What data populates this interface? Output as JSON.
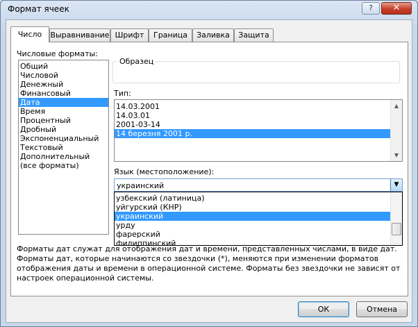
{
  "window": {
    "title": "Формат ячеек",
    "help_label": "?",
    "close_label": "✕"
  },
  "tabs": [
    {
      "label": "Число",
      "active": true
    },
    {
      "label": "Выравнивание",
      "active": false
    },
    {
      "label": "Шрифт",
      "active": false
    },
    {
      "label": "Граница",
      "active": false
    },
    {
      "label": "Заливка",
      "active": false
    },
    {
      "label": "Защита",
      "active": false
    }
  ],
  "formats": {
    "label": "Числовые форматы:",
    "items": [
      "Общий",
      "Числовой",
      "Денежный",
      "Финансовый",
      "Дата",
      "Время",
      "Процентный",
      "Дробный",
      "Экспоненциальный",
      "Текстовый",
      "Дополнительный",
      "(все форматы)"
    ],
    "selected_index": 4
  },
  "sample": {
    "label": "Образец"
  },
  "type": {
    "label": "Тип:",
    "items": [
      "14.03.2001",
      "14.03.01",
      "2001-03-14",
      "14 березня 2001 р."
    ],
    "selected_index": 3
  },
  "locale": {
    "label": "Язык (местоположение):",
    "value": "украинский",
    "options": [
      "узбекский (латиница)",
      "уйгурский (КНР)",
      "украинский",
      "урду",
      "фарерский",
      "филиппинский"
    ],
    "selected_index": 2
  },
  "description": "Форматы дат служат для отображения дат и времени, представленных числами, в виде дат. Форматы дат, которые начинаются со звездочки (*), меняются при изменении форматов отображения даты и времени в операционной системе. Форматы без звездочки не зависят от настроек операционной системы.",
  "buttons": {
    "ok": "ОК",
    "cancel": "Отмена"
  },
  "colors": {
    "selection": "#3399ff",
    "close": "#c7402a"
  }
}
